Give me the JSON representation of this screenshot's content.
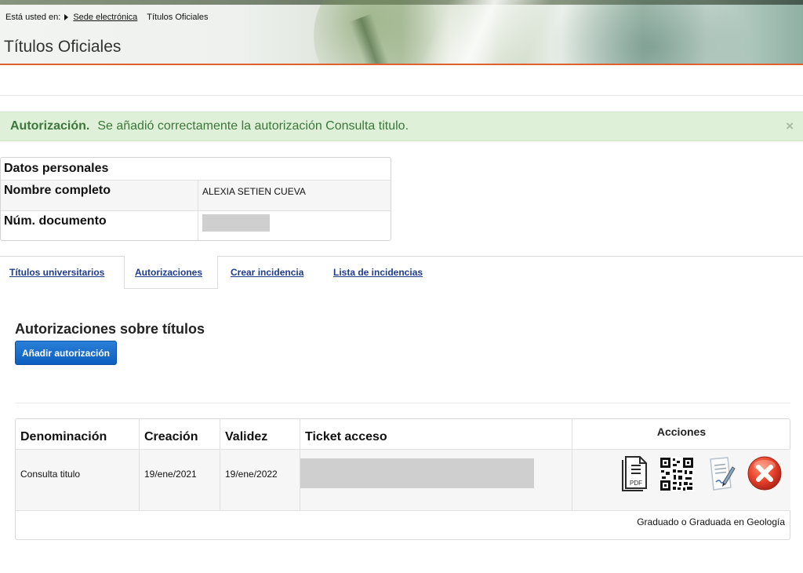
{
  "breadcrumb": {
    "prefix": "Está usted en:",
    "link": "Sede electrónica",
    "current": "Títulos Oficiales"
  },
  "page_title": "Títulos Oficiales",
  "alert": {
    "title": "Autorización.",
    "message": "Se añadió correctamente la autorización Consulta titulo.",
    "close": "×"
  },
  "personal_data": {
    "heading": "Datos personales",
    "name_label": "Nombre completo",
    "name_value": "ALEXIA SETIEN CUEVA",
    "doc_label": "Núm. documento"
  },
  "tabs": [
    {
      "label": "Títulos universitarios"
    },
    {
      "label": "Autorizaciones"
    },
    {
      "label": "Crear incidencia"
    },
    {
      "label": "Lista de incidencias"
    }
  ],
  "section_title": "Autorizaciones sobre títulos",
  "add_button": "Añadir autorización",
  "table": {
    "headers": [
      "Denominación",
      "Creación",
      "Validez",
      "Ticket acceso",
      "Acciones"
    ],
    "rows": [
      {
        "denominacion": "Consulta titulo",
        "creacion": "19/ene/2021",
        "validez": "19/ene/2022",
        "titulo": "Graduado o Graduada en Geología"
      }
    ]
  },
  "icons": {
    "pdf_label": "PDF"
  },
  "colors": {
    "alert_bg": "#dff0d8",
    "alert_text": "#3c763d",
    "accent_orange": "#e1602f",
    "button_blue": "#0d5fbf",
    "tab_link": "#1f3b8c",
    "delete_red": "#e8422a"
  }
}
